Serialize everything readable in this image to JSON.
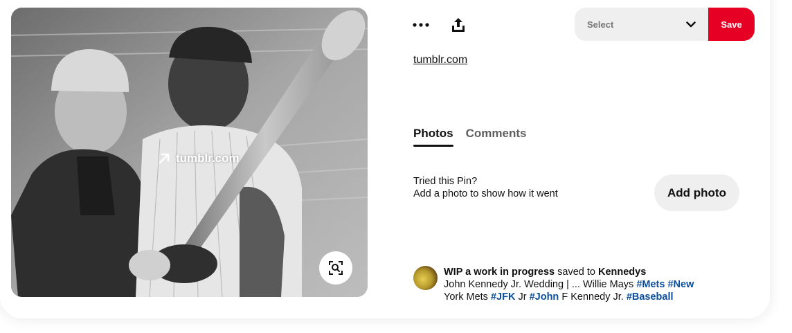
{
  "image": {
    "overlay_link": "tumblr.com"
  },
  "toolbar": {
    "more_icon": "more-dots-icon",
    "share_icon": "share-upload-icon"
  },
  "board_select": {
    "label": "Select"
  },
  "save_label": "Save",
  "source_link": "tumblr.com",
  "tabs": [
    {
      "label": "Photos",
      "active": true
    },
    {
      "label": "Comments",
      "active": false
    }
  ],
  "tried": {
    "line1": "Tried this Pin?",
    "line2": "Add a photo to show how it went",
    "button": "Add photo"
  },
  "saver": {
    "user": "WIP a work in progress",
    "saved_to": "saved to",
    "board": "Kennedys",
    "desc_1": "John Kennedy Jr. Wedding | ... Willie Mays",
    "tag_1": "#Mets",
    "tag_2": "#New",
    "desc_2": "York Mets",
    "tag_3": "#JFK",
    "desc_3": "Jr",
    "tag_4": "#John",
    "desc_4": "F Kennedy Jr.",
    "tag_5": "#Baseball"
  },
  "colors": {
    "save": "#e60023",
    "hashtag": "#0a4e9c",
    "pill_bg": "#efefef"
  }
}
